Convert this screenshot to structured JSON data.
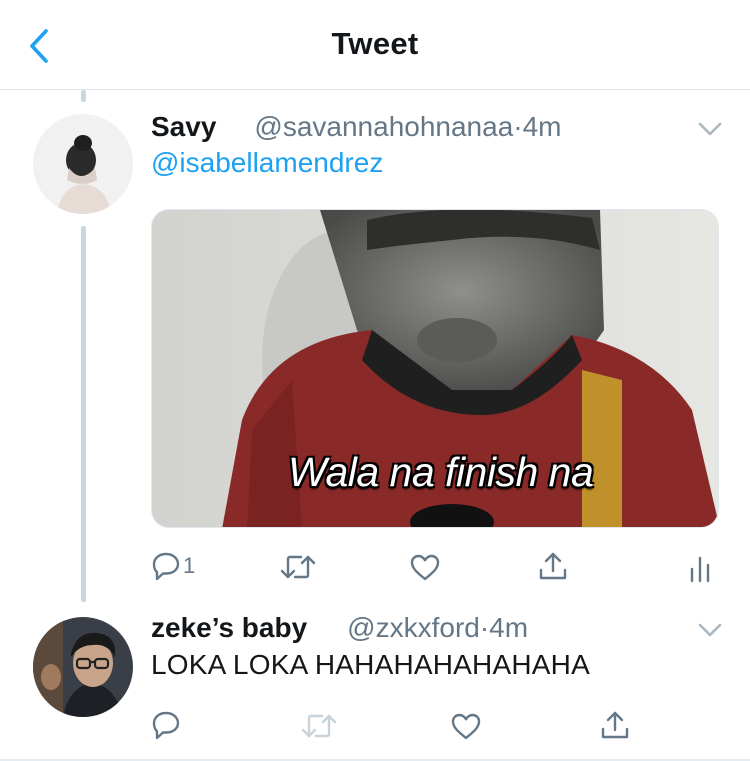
{
  "header": {
    "title": "Tweet"
  },
  "tweets": [
    {
      "name": "Savy",
      "handle": "@savannahohnanaa",
      "separator": "·",
      "time": "4m",
      "mention": "@isabellamendrez",
      "media": {
        "caption": "Wala na finish na"
      },
      "actions": {
        "reply_count": "1"
      }
    },
    {
      "name": "zeke’s baby",
      "handle": "@zxkxford",
      "separator": "·",
      "time": "4m",
      "text": "LOKA LOKA HAHAHAHAHAHAHA"
    }
  ],
  "icons": {
    "back": "chevron-left-icon",
    "menu": "chevron-down-icon",
    "reply": "speech-bubble-icon",
    "retweet": "retweet-arrows-icon",
    "like": "heart-icon",
    "share": "share-upload-icon",
    "analytics": "bar-chart-icon"
  },
  "colors": {
    "accent": "#1da1f2",
    "text": "#14171a",
    "secondary": "#657786",
    "disabled": "#aab8c2",
    "thread_line": "#ccd6dd"
  }
}
